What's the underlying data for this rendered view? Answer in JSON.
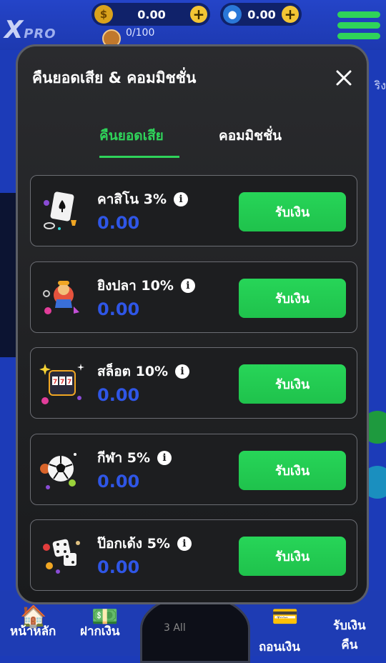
{
  "header": {
    "logo_text": "PRO",
    "coin_balance": "0.00",
    "gem_balance": "0.00",
    "level_progress": "0/100"
  },
  "side": {
    "right_text": "ริง"
  },
  "bottom_nav": {
    "home": "หน้าหลัก",
    "deposit": "ฝากเงิน",
    "center": "3 All",
    "withdraw": "ถอนเงิน",
    "receive_line1": "รับเงิน",
    "receive_line2": "คืน"
  },
  "modal": {
    "title": "คืนยอดเสีย & คอมมิชชั่น",
    "tabs": [
      {
        "label": "คืนยอดเสีย",
        "active": true
      },
      {
        "label": "คอมมิชชั่น",
        "active": false
      }
    ],
    "cards": [
      {
        "name": "คาสิโน 3%",
        "amount": "0.00",
        "button": "รับเงิน",
        "icon": "casino-card-icon"
      },
      {
        "name": "ยิงปลา 10%",
        "amount": "0.00",
        "button": "รับเงิน",
        "icon": "fishing-icon"
      },
      {
        "name": "สล็อต 10%",
        "amount": "0.00",
        "button": "รับเงิน",
        "icon": "slot-machine-icon"
      },
      {
        "name": "กีฬา 5%",
        "amount": "0.00",
        "button": "รับเงิน",
        "icon": "soccer-ball-icon"
      },
      {
        "name": "ป๊อกเด้ง 5%",
        "amount": "0.00",
        "button": "รับเงิน",
        "icon": "dice-icon"
      }
    ]
  },
  "colors": {
    "accent_green": "#2fd35a",
    "amount_blue": "#2f56e6",
    "background_blue": "#1c3bb8",
    "modal_bg": "#202123"
  }
}
